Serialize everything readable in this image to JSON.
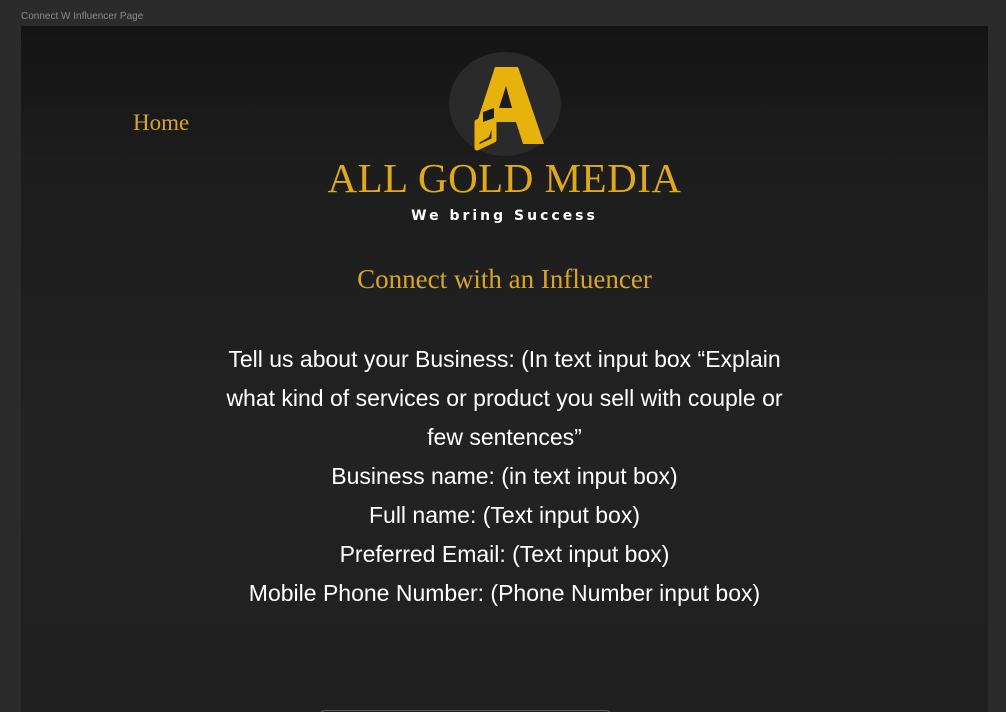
{
  "frame": {
    "label": "Connect W Influencer Page"
  },
  "nav": {
    "home_label": "Home"
  },
  "brand": {
    "logo_icon": "gold-a-logo-icon",
    "title": "ALL GOLD MEDIA",
    "tagline": "We bring Success",
    "accent_color": "#e0a91c"
  },
  "page": {
    "heading": "Connect with an Influencer"
  },
  "form": {
    "business_line1": "Tell us about your Business: (In text input box “Explain",
    "business_line2": "what kind of services or product you sell with couple or",
    "business_line3": "few sentences”",
    "business_name": "Business name: (in text input box)",
    "full_name": "Full name: (Text input box)",
    "email": "Preferred Email: (Text input box)",
    "phone": "Mobile Phone Number: (Phone Number input box)"
  }
}
